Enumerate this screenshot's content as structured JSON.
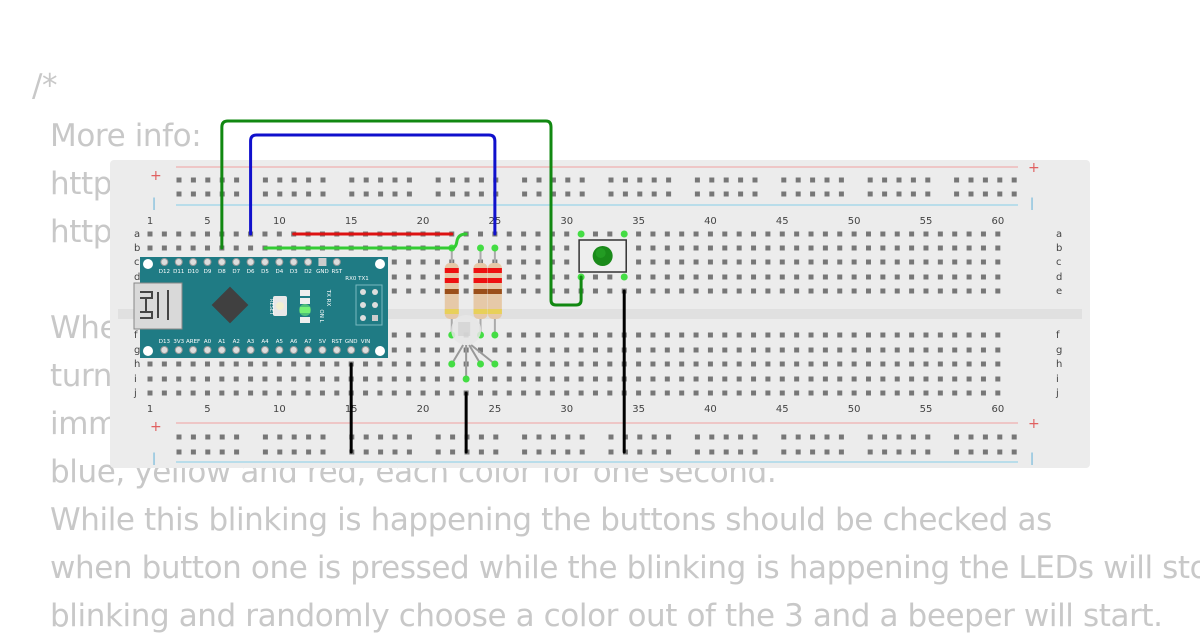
{
  "code_comment": {
    "lines": [
      "/*",
      "More info:",
      "https://www.wokwi.com/arduino/projects/traffic-lights-timers-tasks",
      "https://www.wokwi.com/arduino/projects",
      "",
      "When the program starts, the RGB LED blinks and LEDs and",
      "turn on. After the press of a button, the LED switches",
      "immediately to blinking mode through the colors green,",
      "blue, yellow and red, each color for one second.",
      "While this blinking is happening the buttons should be checked as",
      "when button one is pressed while the blinking is happening the LEDs will stop",
      "blinking and randomly choose a color out of the 3 and a beeper will start."
    ]
  },
  "breadboard": {
    "column_labels": [
      "1",
      "5",
      "10",
      "15",
      "20",
      "25",
      "30",
      "35",
      "40",
      "45",
      "50",
      "55",
      "60"
    ],
    "row_labels_top": [
      "a",
      "b",
      "c",
      "d",
      "e"
    ],
    "row_labels_bottom": [
      "f",
      "g",
      "h",
      "i",
      "j"
    ],
    "rail_plus": "+",
    "rail_minus": "|",
    "colors": {
      "board": "#ececec",
      "hole": "#777777",
      "rail_red": "#f0a0a0",
      "rail_blue": "#a8d8ea",
      "trench": "#e0e0e0",
      "label": "#444444"
    }
  },
  "arduino_nano": {
    "top_pins": [
      "D12",
      "D11",
      "D10",
      "D9",
      "D8",
      "D7",
      "D6",
      "D5",
      "D4",
      "D3",
      "D2",
      "GND",
      "RST"
    ],
    "top_extra": "RX0 TX1",
    "bottom_pins": [
      "D13",
      "3V3",
      "AREF",
      "A0",
      "A1",
      "A2",
      "A3",
      "A4",
      "A5",
      "A6",
      "A7",
      "5V",
      "RST",
      "GND",
      "VIN"
    ],
    "reset_label": "RESET",
    "led_labels": [
      "TX",
      "RX",
      "ON",
      "L"
    ],
    "board_color": "#1f7b84"
  },
  "components": {
    "resistors": [
      {
        "name": "resistor-1",
        "column": 22
      },
      {
        "name": "resistor-2",
        "column": 24
      },
      {
        "name": "resistor-3",
        "column": 25
      }
    ],
    "rgb_led": {
      "name": "rgb-led",
      "column": 23
    },
    "pushbutton": {
      "name": "pushbutton",
      "color": "#1a8a1a",
      "columns": [
        31,
        34
      ]
    }
  },
  "wires": [
    {
      "name": "wire-green-d7",
      "color": "#118811"
    },
    {
      "name": "wire-blue-d6",
      "color": "#1010cc"
    },
    {
      "name": "wire-red-row-a",
      "color": "#dd1111"
    },
    {
      "name": "wire-lightgreen-row-b",
      "color": "#33cc33"
    },
    {
      "name": "wire-black-gnd-nano",
      "color": "#000000"
    },
    {
      "name": "wire-black-gnd-led",
      "color": "#000000"
    },
    {
      "name": "wire-black-gnd-button",
      "color": "#000000"
    }
  ]
}
